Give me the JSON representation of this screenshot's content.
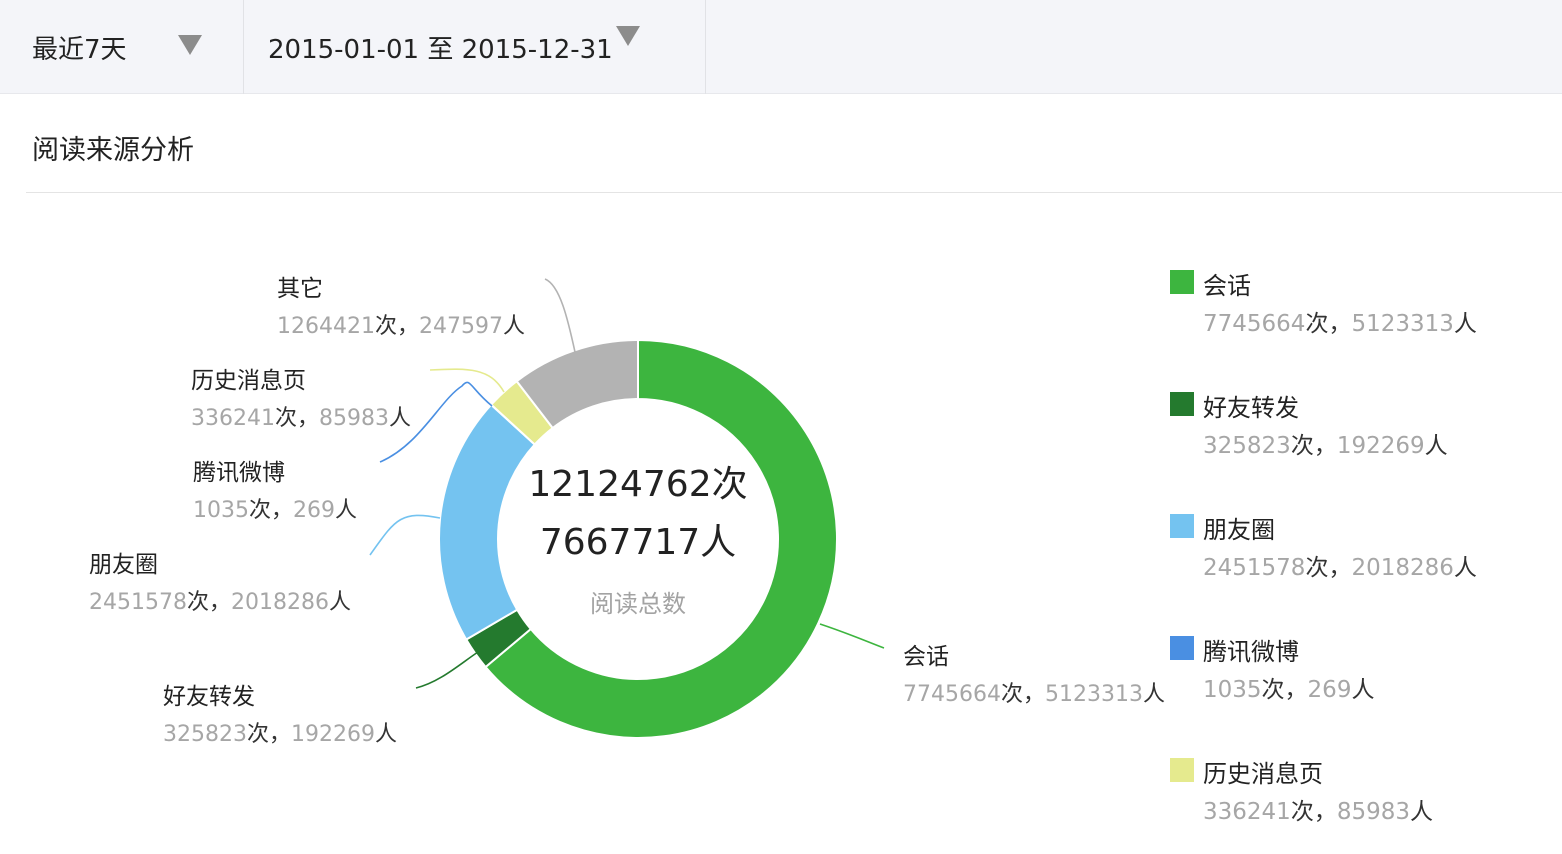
{
  "filters": {
    "range_label": "最近7天",
    "date_range": "2015-01-01 至 2015-12-31"
  },
  "section_title": "阅读来源分析",
  "units": {
    "times": "次",
    "people": "人",
    "sep": "，"
  },
  "center": {
    "total_times": "12124762次",
    "total_people": "7667717人",
    "caption": "阅读总数"
  },
  "chart_data": {
    "type": "pie",
    "donut": true,
    "legend_position": "right",
    "slices": [
      {
        "name": "会话",
        "times": 7745664,
        "people": 5123313,
        "color": "#3db53f"
      },
      {
        "name": "好友转发",
        "times": 325823,
        "people": 192269,
        "color": "#247a2e"
      },
      {
        "name": "朋友圈",
        "times": 2451578,
        "people": 2018286,
        "color": "#74c3f0"
      },
      {
        "name": "腾讯微博",
        "times": 1035,
        "people": 269,
        "color": "#4a8fe2"
      },
      {
        "name": "历史消息页",
        "times": 336241,
        "people": 85983,
        "color": "#e5ea8e"
      },
      {
        "name": "其它",
        "times": 1264421,
        "people": 247597,
        "color": "#b3b3b3"
      }
    ],
    "legend_entries": [
      {
        "name": "会话",
        "times": 7745664,
        "people": 5123313,
        "color": "#3db53f"
      },
      {
        "name": "好友转发",
        "times": 325823,
        "people": 192269,
        "color": "#247a2e"
      },
      {
        "name": "朋友圈",
        "times": 2451578,
        "people": 2018286,
        "color": "#74c3f0"
      },
      {
        "name": "腾讯微博",
        "times": 1035,
        "people": 269,
        "color": "#4a8fe2"
      },
      {
        "name": "历史消息页",
        "times": 336241,
        "people": 85983,
        "color": "#e5ea8e"
      }
    ]
  }
}
